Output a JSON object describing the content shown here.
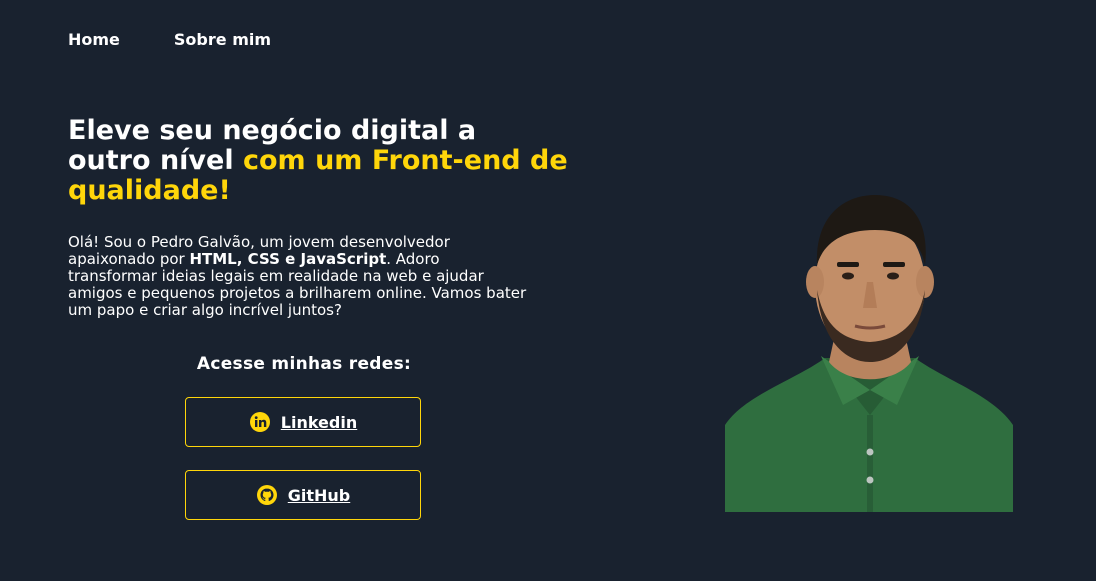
{
  "nav": {
    "items": [
      {
        "label": "Home"
      },
      {
        "label": "Sobre mim"
      }
    ]
  },
  "hero": {
    "title_part1": "Eleve seu negócio digital a outro nível ",
    "title_highlight": "com um Front-end de qualidade!",
    "intro_part1": "Olá! Sou o Pedro Galvão, um jovem desenvolvedor apaixonado por ",
    "intro_bold": "HTML, CSS e JavaScript",
    "intro_part2": ". Adoro transformar ideias legais em realidade na web e ajudar amigos e pequenos projetos a brilharem online. Vamos bater um papo e criar algo incrível juntos?"
  },
  "social": {
    "heading": "Acesse minhas redes:",
    "buttons": [
      {
        "label": "Linkedin",
        "icon": "linkedin-icon"
      },
      {
        "label": "GitHub",
        "icon": "github-icon"
      }
    ]
  },
  "colors": {
    "background": "#19222f",
    "accent": "#ffd60a",
    "text": "#ffffff",
    "shirt": "#2f6e3f"
  }
}
